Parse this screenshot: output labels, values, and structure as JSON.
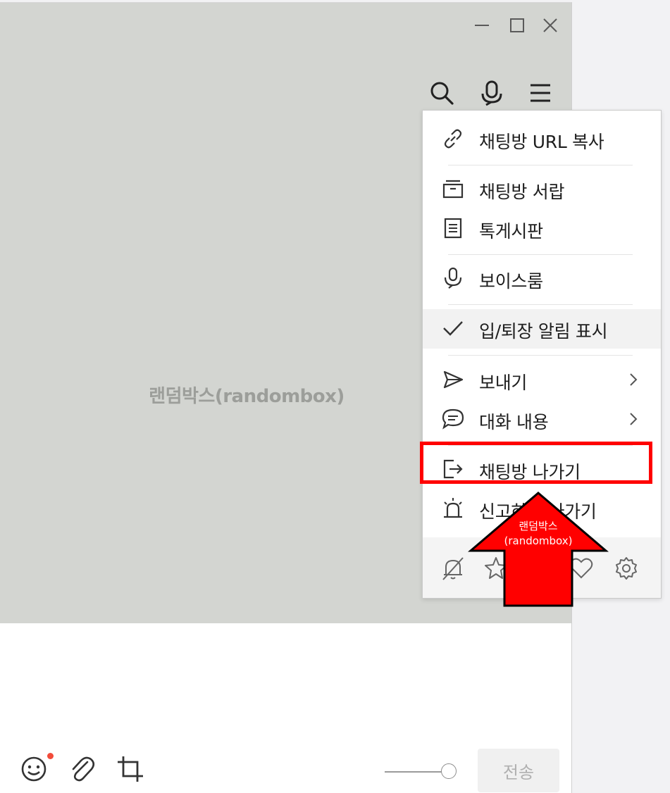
{
  "chat": {
    "room_name": "랜덤박스(randombox)"
  },
  "window_controls": {
    "minimize_icon": "minimize-icon",
    "maximize_icon": "maximize-icon",
    "close_icon": "close-icon"
  },
  "header": {
    "search_icon": "search-icon",
    "voice_icon": "microphone-icon",
    "menu_icon": "hamburger-menu-icon"
  },
  "menu": {
    "items": [
      {
        "label": "채팅방 URL 복사",
        "icon": "link-icon"
      },
      {
        "label": "채팅방 서랍",
        "icon": "drawer-icon"
      },
      {
        "label": "톡게시판",
        "icon": "board-icon"
      },
      {
        "label": "보이스룸",
        "icon": "voice-room-icon"
      },
      {
        "label": "입/퇴장 알림 표시",
        "icon": "checkmark-icon",
        "checked": true
      },
      {
        "label": "보내기",
        "icon": "send-icon",
        "submenu": true
      },
      {
        "label": "대화 내용",
        "icon": "chat-bubble-icon",
        "submenu": true
      },
      {
        "label": "채팅방 나가기",
        "icon": "exit-icon"
      },
      {
        "label": "신고하고 나가기",
        "icon": "siren-icon"
      }
    ],
    "bottom_icons": [
      "bell-off-icon",
      "star-icon",
      "heart-icon",
      "gear-icon"
    ]
  },
  "input": {
    "send_label": "전송"
  },
  "annotation": {
    "arrow_text_line1": "랜덤박스",
    "arrow_text_line2": "(randombox)",
    "highlight_color": "#ff0000"
  },
  "colors": {
    "chat_background": "#d3d5d1",
    "notification_dot": "#f24b3a"
  }
}
